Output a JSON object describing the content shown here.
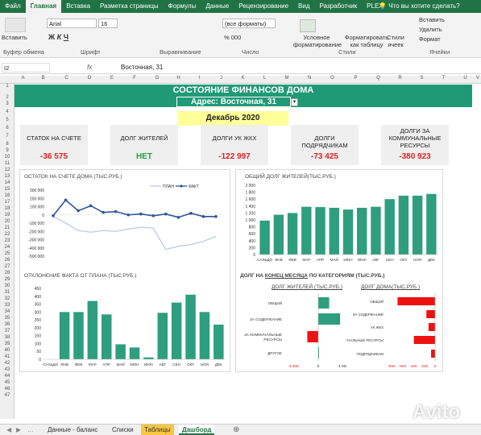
{
  "ribbon_tabs": [
    "Файл",
    "Главная",
    "Вставка",
    "Разметка страницы",
    "Формулы",
    "Данные",
    "Рецензирование",
    "Вид",
    "Разработчик",
    "PLEX"
  ],
  "tell_me": "Что вы хотите сделать?",
  "ribbon": {
    "paste": "Вставить",
    "font_name": "Arial",
    "font_size": "16",
    "number_format": "(все форматы)",
    "cond_fmt": "Условное форматирование",
    "fmt_table": "Форматировать как таблицу",
    "cell_styles": "Стили ячеек",
    "insert": "Вставить",
    "delete": "Удалить",
    "format": "Формат",
    "groups": [
      "Буфер обмена",
      "Шрифт",
      "Выравнивание",
      "Число",
      "Стили",
      "Ячейки"
    ]
  },
  "formula_bar": {
    "cell_ref": "I2",
    "fx": "fx",
    "value": "Восточная, 31"
  },
  "columns": [
    "A",
    "B",
    "C",
    "D",
    "E",
    "F",
    "G",
    "H",
    "I",
    "J",
    "K",
    "L",
    "M",
    "N",
    "O",
    "P",
    "Q",
    "R",
    "S",
    "T",
    "U",
    "V"
  ],
  "rows": [
    "1",
    "2",
    "3",
    "4",
    "5",
    "6",
    "7",
    "8",
    "9",
    "10",
    "11",
    "12",
    "13",
    "14",
    "15",
    "16",
    "17",
    "18",
    "19",
    "20",
    "21",
    "22",
    "23",
    "24",
    "25",
    "26",
    "27",
    "28",
    "29",
    "30",
    "31",
    "32",
    "33",
    "34",
    "35",
    "36",
    "37",
    "38",
    "39",
    "40",
    "41",
    "42",
    "43",
    "44",
    "45",
    "46",
    "47"
  ],
  "dashboard": {
    "title": "СОСТОЯНИЕ ФИНАНСОВ ДОМА",
    "address": "Адрес: Восточная, 31",
    "month": "Декабрь 2020"
  },
  "kpis": [
    {
      "label": "СТАТОК НА СЧЕТЕ",
      "value": "-36 575",
      "color": "#e02020"
    },
    {
      "label": "ДОЛГ ЖИТЕЛЕЙ",
      "value": "НЕТ",
      "color": "#20a040"
    },
    {
      "label": "ДОЛГИ УК ЖКХ",
      "value": "-122 997",
      "color": "#e02020"
    },
    {
      "label": "ДОЛГИ ПОДРЯДЧИКАМ",
      "value": "-73 425",
      "color": "#e02020"
    },
    {
      "label": "ДОЛГИ ЗА КОММУНАЛЬНЫЕ РЕСУРСЫ",
      "value": "-380 923",
      "color": "#e02020"
    }
  ],
  "months": [
    "ЯНВ",
    "ФЕВ",
    "МАР",
    "АПР",
    "МАЙ",
    "ИЮН",
    "ИЮЛ",
    "АВГ",
    "СЕН",
    "ОКТ",
    "НОЯ",
    "ДЕК"
  ],
  "chart_data": [
    {
      "type": "line",
      "title": "ОСТАТОК НА СЧЕТЕ ДОМА (ТЫС.РУБ.)",
      "y_ticks": [
        "300 000",
        "200 000",
        "100 000",
        "0",
        "-100 000",
        "-200 000",
        "-300 000",
        "-400 000",
        "-500 000"
      ],
      "ylim": [
        -500000,
        300000
      ],
      "series": [
        {
          "name": "ПЛАН",
          "color": "#b8cce4",
          "values": [
            -20000,
            -100000,
            -190000,
            -210000,
            -190000,
            -200000,
            -170000,
            -150000,
            -160000,
            -420000,
            -380000,
            -360000,
            -320000,
            -260000
          ]
        },
        {
          "name": "ФАКТ",
          "color": "#2e5597",
          "values": [
            -10000,
            180000,
            50000,
            110000,
            30000,
            40000,
            0,
            10000,
            -10000,
            10000,
            -30000,
            20000,
            -20000,
            -20000
          ]
        }
      ]
    },
    {
      "type": "bar",
      "title": "ОБЩИЙ ДОЛГ ЖИТЕЛЕЙ(ТЫС.РУБ.)",
      "categories": [
        "САЛЬДО",
        "ЯНВ",
        "ФЕВ",
        "МАР",
        "АПР",
        "МАЙ",
        "ИЮН",
        "ИЮЛ",
        "АВГ",
        "СЕН",
        "ОКТ",
        "НОЯ",
        "ДЕК"
      ],
      "y_ticks": [
        "2 000",
        "1 800",
        "1 600",
        "1 400",
        "1 200",
        "1 000",
        "800",
        "600",
        "400",
        "200",
        "0"
      ],
      "ylim": [
        0,
        2000
      ],
      "values": [
        980,
        1150,
        1200,
        1380,
        1370,
        1350,
        1300,
        1350,
        1380,
        1600,
        1700,
        1700,
        1750
      ]
    },
    {
      "type": "bar",
      "title": "ОТКЛОНЕНИЕ ФАКТА ОТ ПЛАНА (ТЫС.РУБ.)",
      "categories": [
        "САЛЬДО",
        "ЯНВ",
        "ФЕВ",
        "МАР",
        "АПР",
        "МАЙ",
        "ИЮН",
        "ИЮЛ",
        "АВГ",
        "СЕН",
        "ОКТ",
        "НОЯ",
        "ДЕК"
      ],
      "y_ticks": [
        "450",
        "400",
        "350",
        "300",
        "250",
        "200",
        "150",
        "100",
        "50",
        "0"
      ],
      "ylim": [
        0,
        450
      ],
      "values": [
        0,
        300,
        300,
        370,
        285,
        95,
        75,
        12,
        295,
        360,
        410,
        300,
        220
      ]
    },
    {
      "type": "bar",
      "title": "ДОЛГ ЖИТЕЛЕЙ (ТЫС.РУБ.)",
      "orientation": "horizontal",
      "categories": [
        "ОБЩИЙ",
        "ЗА СОДЕРЖАНИЕ",
        "ЗА КОММУНАЛЬНЫЕ РЕСУРСЫ",
        "ДРУГОЕ"
      ],
      "x_ticks": [
        "-4 000",
        "0",
        "4 000"
      ],
      "xlim": [
        -4000,
        4000
      ],
      "values": [
        1750,
        3500,
        -1750,
        0
      ]
    },
    {
      "type": "bar",
      "title": "ДОЛГ ДОМА(ТЫС.РУБ.)",
      "orientation": "horizontal",
      "categories": [
        "ОБЩИЙ",
        "ЗА СОДЕРЖАНИЕ",
        "УК ЖКХ",
        "ЗА КОММУНАЛЬНЫЕ РЕСУРСЫ",
        "ПОДРЯДЧИКАМ"
      ],
      "x_ticks": [
        "-800",
        "-600",
        "-400",
        "-200",
        "0"
      ],
      "xlim": [
        -800,
        0
      ],
      "values": [
        -690,
        -160,
        -120,
        -390,
        -73
      ]
    }
  ],
  "debt_header": {
    "pre": "ДОЛГ НА ",
    "underlined": "КОНЕЦ МЕСЯЦА",
    "post": " ПО КАТЕГОРИЯМ (ТЫС.РУБ.)"
  },
  "sheet_tabs": [
    "Данные - баланс",
    "Списки",
    "Таблицы",
    "Дашборд"
  ],
  "watermark": "Avito",
  "colors": {
    "excel_green": "#217346",
    "teal": "#1f9a76",
    "bar": "#2e9e7e",
    "red": "#ee1111",
    "yellow": "#ffff99"
  }
}
